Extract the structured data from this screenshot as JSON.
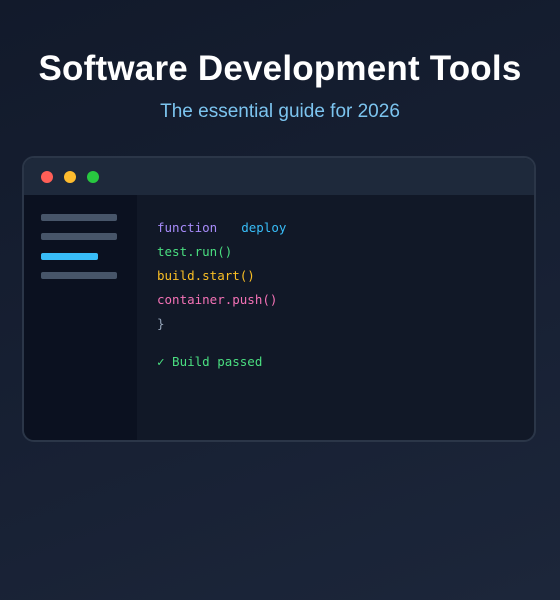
{
  "header": {
    "title": "Software Development Tools",
    "subtitle": "The essential guide for 2026"
  },
  "editor": {
    "colors": {
      "close": "#ff5f57",
      "minimize": "#febc2e",
      "maximize": "#28c840",
      "accent": "#38bdf8"
    },
    "code": {
      "keyword": "function",
      "function_name": "deploy",
      "line2": "test.run()",
      "line3": "build.start()",
      "line4": "container.push()",
      "line5": "}",
      "status": "✓ Build passed"
    }
  }
}
